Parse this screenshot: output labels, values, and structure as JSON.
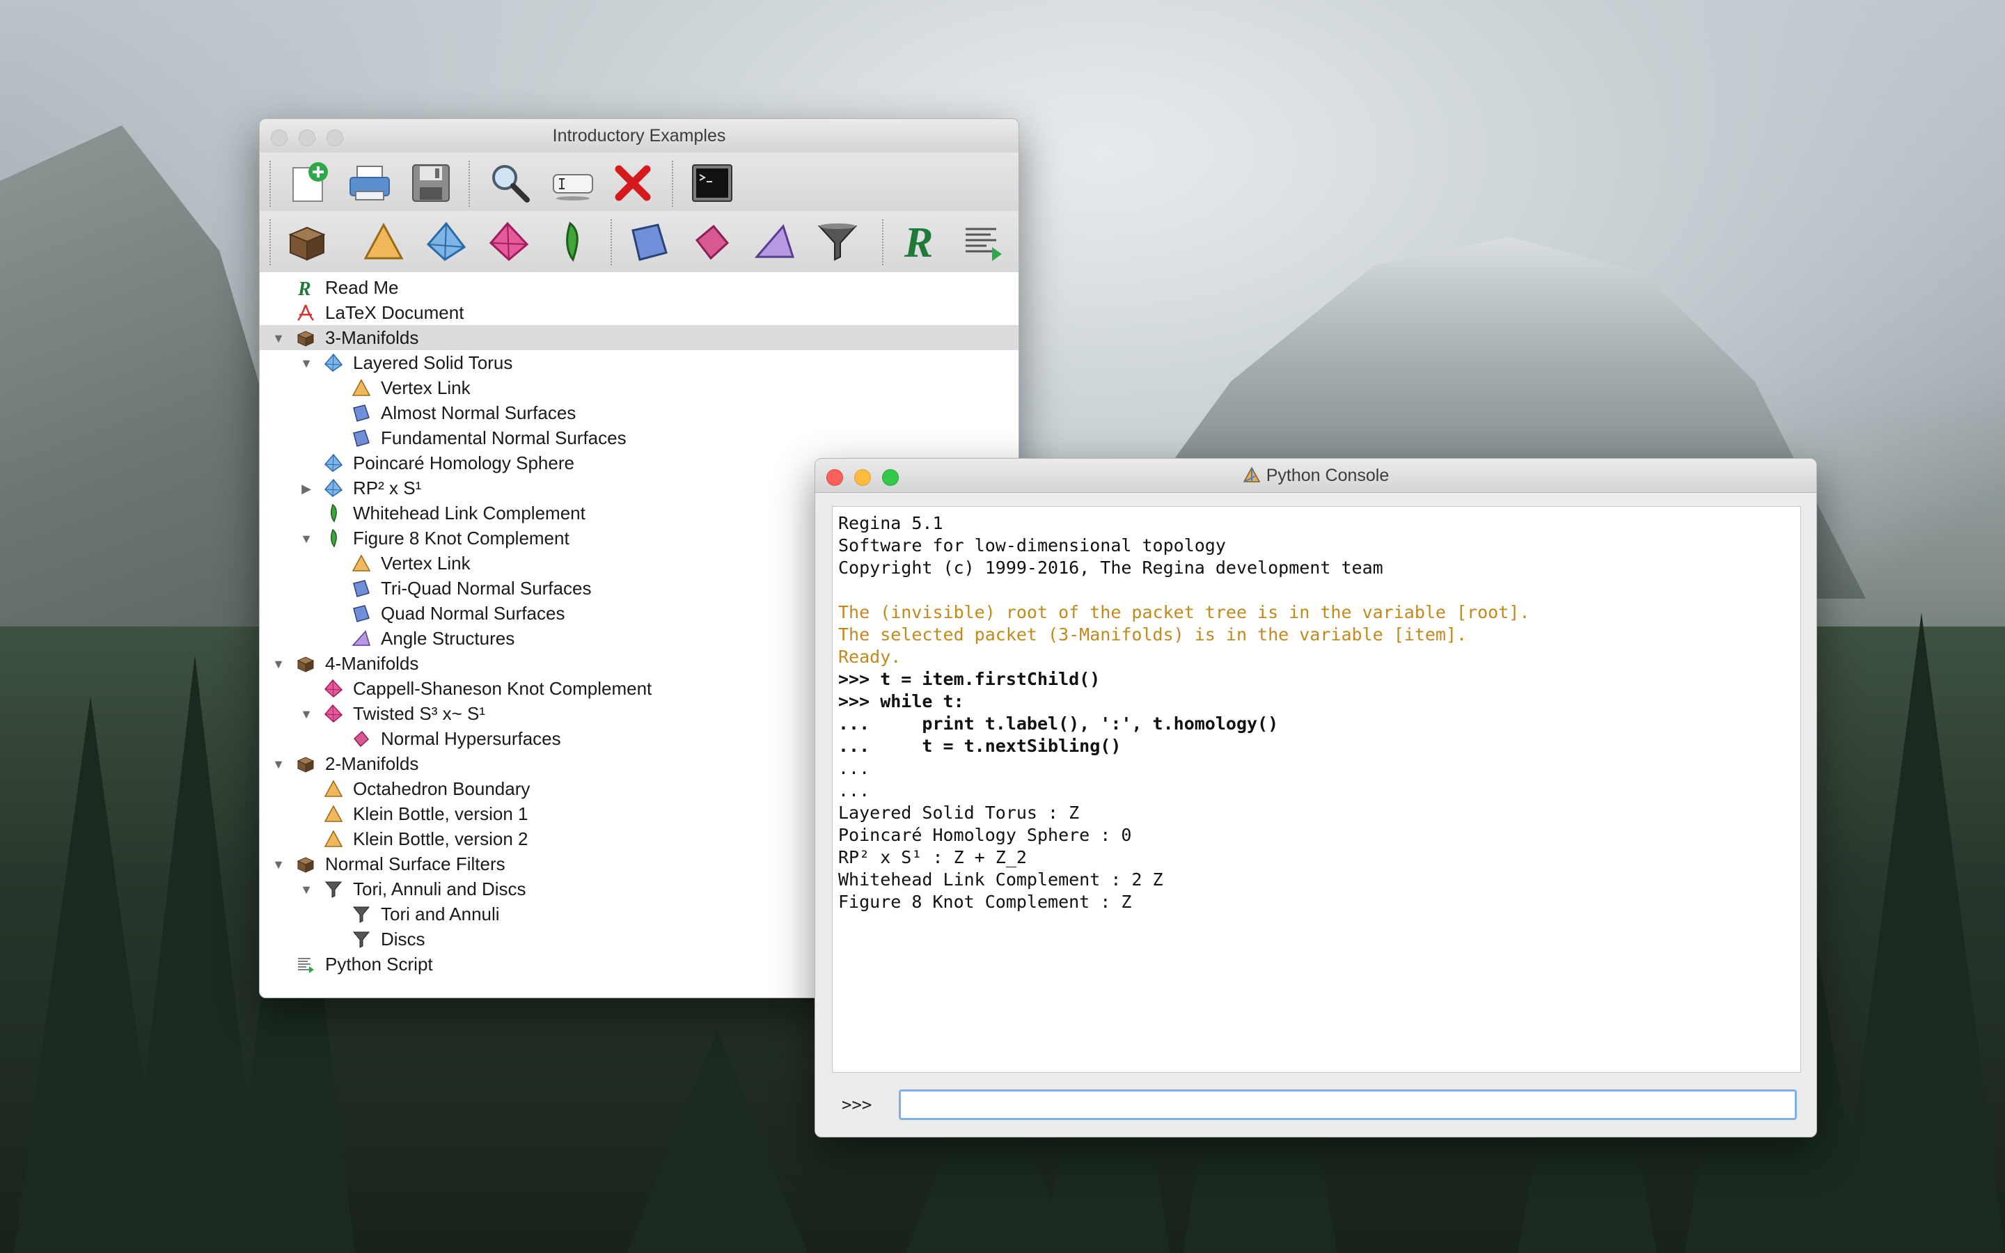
{
  "main_window": {
    "title": "Introductory Examples",
    "toolbar1": [
      {
        "icon": "new-packet-icon"
      },
      {
        "icon": "print-icon"
      },
      {
        "icon": "save-icon"
      },
      {
        "icon": "search-icon"
      },
      {
        "icon": "rename-icon"
      },
      {
        "icon": "delete-icon"
      },
      {
        "icon": "terminal-icon"
      }
    ],
    "toolbar2": [
      {
        "icon": "container-icon"
      },
      {
        "icon": "2d-triangulation-icon"
      },
      {
        "icon": "3d-triangulation-icon"
      },
      {
        "icon": "4d-triangulation-icon"
      },
      {
        "icon": "snappea-icon"
      },
      {
        "icon": "normal-surfaces-icon"
      },
      {
        "icon": "normal-hypersurfaces-icon"
      },
      {
        "icon": "angle-structures-icon"
      },
      {
        "icon": "filter-icon"
      },
      {
        "icon": "text-icon"
      },
      {
        "icon": "script-icon"
      }
    ],
    "tree": [
      {
        "label": "Read Me",
        "icon": "text-icon",
        "level": 0
      },
      {
        "label": "LaTeX Document",
        "icon": "pdf-icon",
        "level": 0
      },
      {
        "label": "3-Manifolds",
        "icon": "container-icon",
        "level": 0,
        "expanded": true,
        "selected": true
      },
      {
        "label": "Layered Solid Torus",
        "icon": "3d-triangulation-icon",
        "level": 1,
        "expanded": true
      },
      {
        "label": "Vertex Link",
        "icon": "2d-triangulation-icon",
        "level": 2
      },
      {
        "label": "Almost Normal Surfaces",
        "icon": "normal-surfaces-icon",
        "level": 2
      },
      {
        "label": "Fundamental Normal Surfaces",
        "icon": "normal-surfaces-icon",
        "level": 2
      },
      {
        "label": "Poincaré Homology Sphere",
        "icon": "3d-triangulation-icon",
        "level": 1
      },
      {
        "label": "RP² x S¹",
        "icon": "3d-triangulation-icon",
        "level": 1,
        "collapsed": true
      },
      {
        "label": "Whitehead Link Complement",
        "icon": "snappea-icon",
        "level": 1
      },
      {
        "label": "Figure 8 Knot Complement",
        "icon": "snappea-icon",
        "level": 1,
        "expanded": true
      },
      {
        "label": "Vertex Link",
        "icon": "2d-triangulation-icon",
        "level": 2
      },
      {
        "label": "Tri-Quad Normal Surfaces",
        "icon": "normal-surfaces-icon",
        "level": 2
      },
      {
        "label": "Quad Normal Surfaces",
        "icon": "normal-surfaces-icon",
        "level": 2
      },
      {
        "label": "Angle Structures",
        "icon": "angle-structures-icon",
        "level": 2
      },
      {
        "label": "4-Manifolds",
        "icon": "container-icon",
        "level": 0,
        "expanded": true
      },
      {
        "label": "Cappell-Shaneson Knot Complement",
        "icon": "4d-triangulation-icon",
        "level": 1
      },
      {
        "label": "Twisted S³ x~ S¹",
        "icon": "4d-triangulation-icon",
        "level": 1,
        "expanded": true
      },
      {
        "label": "Normal Hypersurfaces",
        "icon": "normal-hypersurfaces-icon",
        "level": 2
      },
      {
        "label": "2-Manifolds",
        "icon": "container-icon",
        "level": 0,
        "expanded": true
      },
      {
        "label": "Octahedron Boundary",
        "icon": "2d-triangulation-icon",
        "level": 1
      },
      {
        "label": "Klein Bottle, version 1",
        "icon": "2d-triangulation-icon",
        "level": 1
      },
      {
        "label": "Klein Bottle, version 2",
        "icon": "2d-triangulation-icon",
        "level": 1
      },
      {
        "label": "Normal Surface Filters",
        "icon": "container-icon",
        "level": 0,
        "expanded": true
      },
      {
        "label": "Tori, Annuli and Discs",
        "icon": "filter-icon",
        "level": 1,
        "expanded": true
      },
      {
        "label": "Tori and Annuli",
        "icon": "filter-icon",
        "level": 2
      },
      {
        "label": "Discs",
        "icon": "filter-icon",
        "level": 2
      },
      {
        "label": "Python Script",
        "icon": "script-icon",
        "level": 0
      }
    ]
  },
  "console_window": {
    "title": "Python Console",
    "output": [
      {
        "text": "Regina 5.1",
        "style": "normal"
      },
      {
        "text": "Software for low-dimensional topology",
        "style": "normal"
      },
      {
        "text": "Copyright (c) 1999-2016, The Regina development team",
        "style": "normal"
      },
      {
        "text": "",
        "style": "normal"
      },
      {
        "text": "The (invisible) root of the packet tree is in the variable [root].",
        "style": "orange"
      },
      {
        "text": "The selected packet (3-Manifolds) is in the variable [item].",
        "style": "orange"
      },
      {
        "text": "Ready.",
        "style": "orange"
      },
      {
        "text": ">>> t = item.firstChild()",
        "style": "bold"
      },
      {
        "text": ">>> while t:",
        "style": "bold"
      },
      {
        "text": "...     print t.label(), ':', t.homology()",
        "style": "bold"
      },
      {
        "text": "...     t = t.nextSibling()",
        "style": "bold"
      },
      {
        "text": "...",
        "style": "normal"
      },
      {
        "text": "...",
        "style": "normal"
      },
      {
        "text": "Layered Solid Torus : Z",
        "style": "normal"
      },
      {
        "text": "Poincaré Homology Sphere : 0",
        "style": "normal"
      },
      {
        "text": "RP² x S¹ : Z + Z_2",
        "style": "normal"
      },
      {
        "text": "Whitehead Link Complement : 2 Z",
        "style": "normal"
      },
      {
        "text": "Figure 8 Knot Complement : Z",
        "style": "normal"
      }
    ],
    "prompt": ">>>",
    "input_value": ""
  },
  "colors": {
    "close": "#fc605b",
    "minimize": "#fdbc40",
    "zoom": "#34c84a",
    "inactive_light": "#d3d3d3",
    "console_orange": "#c08a1e",
    "selection": "#dcdcdc"
  }
}
